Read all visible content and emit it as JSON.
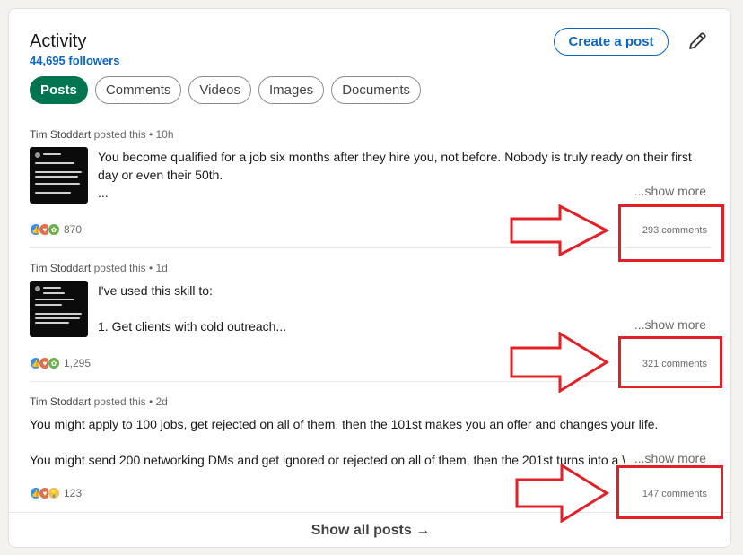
{
  "header": {
    "title": "Activity",
    "followers": "44,695 followers",
    "create_post_label": "Create a post"
  },
  "tabs": [
    {
      "label": "Posts",
      "active": true
    },
    {
      "label": "Comments",
      "active": false
    },
    {
      "label": "Videos",
      "active": false
    },
    {
      "label": "Images",
      "active": false
    },
    {
      "label": "Documents",
      "active": false
    }
  ],
  "posts": [
    {
      "author": "Tim Stoddart",
      "posted": "posted this • 10h",
      "line1": "You become qualified for a job six months after they hire you, not before. Nobody is truly ready on their first",
      "line2": "day or even their 50th.",
      "line3": "...",
      "show_more": "...show more",
      "reactions_count": "870",
      "reaction_icons": [
        "like",
        "love",
        "support"
      ],
      "comments": "293 comments"
    },
    {
      "author": "Tim Stoddart",
      "posted": "posted this • 1d",
      "line1": "I've used this skill to:",
      "line2": "",
      "line3": "1. Get clients with cold outreach...",
      "show_more": "...show more",
      "reactions_count": "1,295",
      "reaction_icons": [
        "like",
        "love",
        "support"
      ],
      "comments": "321 comments"
    },
    {
      "author": "Tim Stoddart",
      "posted": "posted this • 2d",
      "line1": "You might apply to 100 jobs, get rejected on all of them, then the 101st makes you an offer and changes your life.",
      "line2": "",
      "line3": "You might send 200 networking DMs and get ignored or rejected on all of them, then the 201st turns into a \\",
      "show_more": "...show more",
      "reactions_count": "123",
      "reaction_icons": [
        "like",
        "love",
        "insight"
      ],
      "comments": "147 comments"
    }
  ],
  "footer": {
    "show_all": "Show all posts →"
  },
  "colors": {
    "accent": "#0a66c2",
    "active_tab": "#01754f",
    "annotation_red": "#e32027"
  }
}
